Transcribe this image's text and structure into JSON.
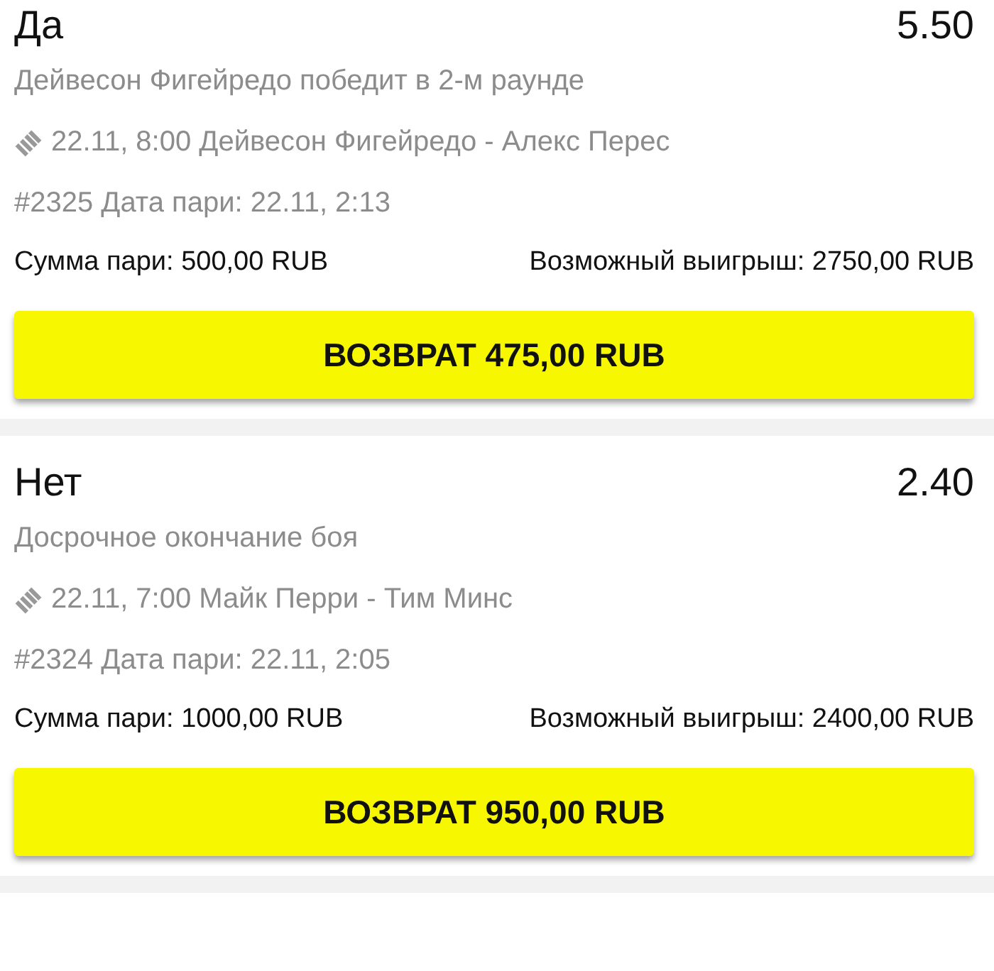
{
  "bets": [
    {
      "outcome": "Да",
      "odds": "5.50",
      "market": "Дейвесон Фигейредо победит в 2-м раунде",
      "event": "22.11, 8:00 Дейвесон Фигейредо - Алекс Перес",
      "bet_info": "#2325 Дата пари: 22.11, 2:13",
      "stake": "Сумма пари: 500,00 RUB",
      "possible_win": "Возможный выигрыш: 2750,00 RUB",
      "button": "ВОЗВРАТ 475,00 RUB"
    },
    {
      "outcome": "Нет",
      "odds": "2.40",
      "market": "Досрочное окончание боя",
      "event": "22.11, 7:00 Майк Перри - Тим Минс",
      "bet_info": "#2324 Дата пари: 22.11, 2:05",
      "stake": "Сумма пари: 1000,00 RUB",
      "possible_win": "Возможный выигрыш: 2400,00 RUB",
      "button": "ВОЗВРАТ 950,00 RUB"
    }
  ]
}
